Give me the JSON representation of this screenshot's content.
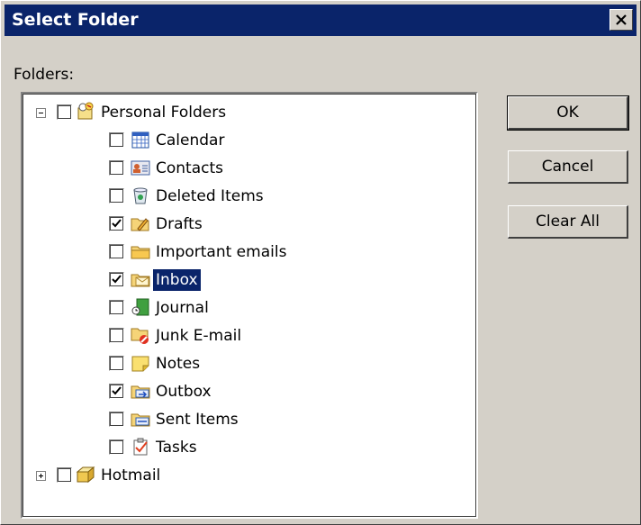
{
  "window": {
    "title": "Select Folder"
  },
  "folders_label": "Folders:",
  "buttons": {
    "ok": "OK",
    "cancel": "Cancel",
    "clear_all": "Clear All"
  },
  "tree": {
    "root": {
      "label": "Personal Folders",
      "expanded": true,
      "checked": false,
      "icon": "personal-folders-icon"
    },
    "items": [
      {
        "label": "Calendar",
        "checked": false,
        "icon": "calendar-icon"
      },
      {
        "label": "Contacts",
        "checked": false,
        "icon": "contacts-icon"
      },
      {
        "label": "Deleted Items",
        "checked": false,
        "icon": "deleted-items-icon"
      },
      {
        "label": "Drafts",
        "checked": true,
        "icon": "drafts-icon"
      },
      {
        "label": "Important emails",
        "checked": false,
        "icon": "folder-icon"
      },
      {
        "label": "Inbox",
        "checked": true,
        "icon": "inbox-icon",
        "selected": true
      },
      {
        "label": "Journal",
        "checked": false,
        "icon": "journal-icon"
      },
      {
        "label": "Junk E-mail",
        "checked": false,
        "icon": "junk-email-icon"
      },
      {
        "label": "Notes",
        "checked": false,
        "icon": "notes-icon"
      },
      {
        "label": "Outbox",
        "checked": true,
        "icon": "outbox-icon"
      },
      {
        "label": "Sent Items",
        "checked": false,
        "icon": "sent-items-icon"
      },
      {
        "label": "Tasks",
        "checked": false,
        "icon": "tasks-icon"
      }
    ],
    "second_root": {
      "label": "Hotmail",
      "expanded": false,
      "checked": false,
      "icon": "hotmail-folder-icon"
    }
  },
  "colors": {
    "face": "#d4d0c8",
    "title_bar": "#0a246a",
    "selection": "#0a246a"
  }
}
